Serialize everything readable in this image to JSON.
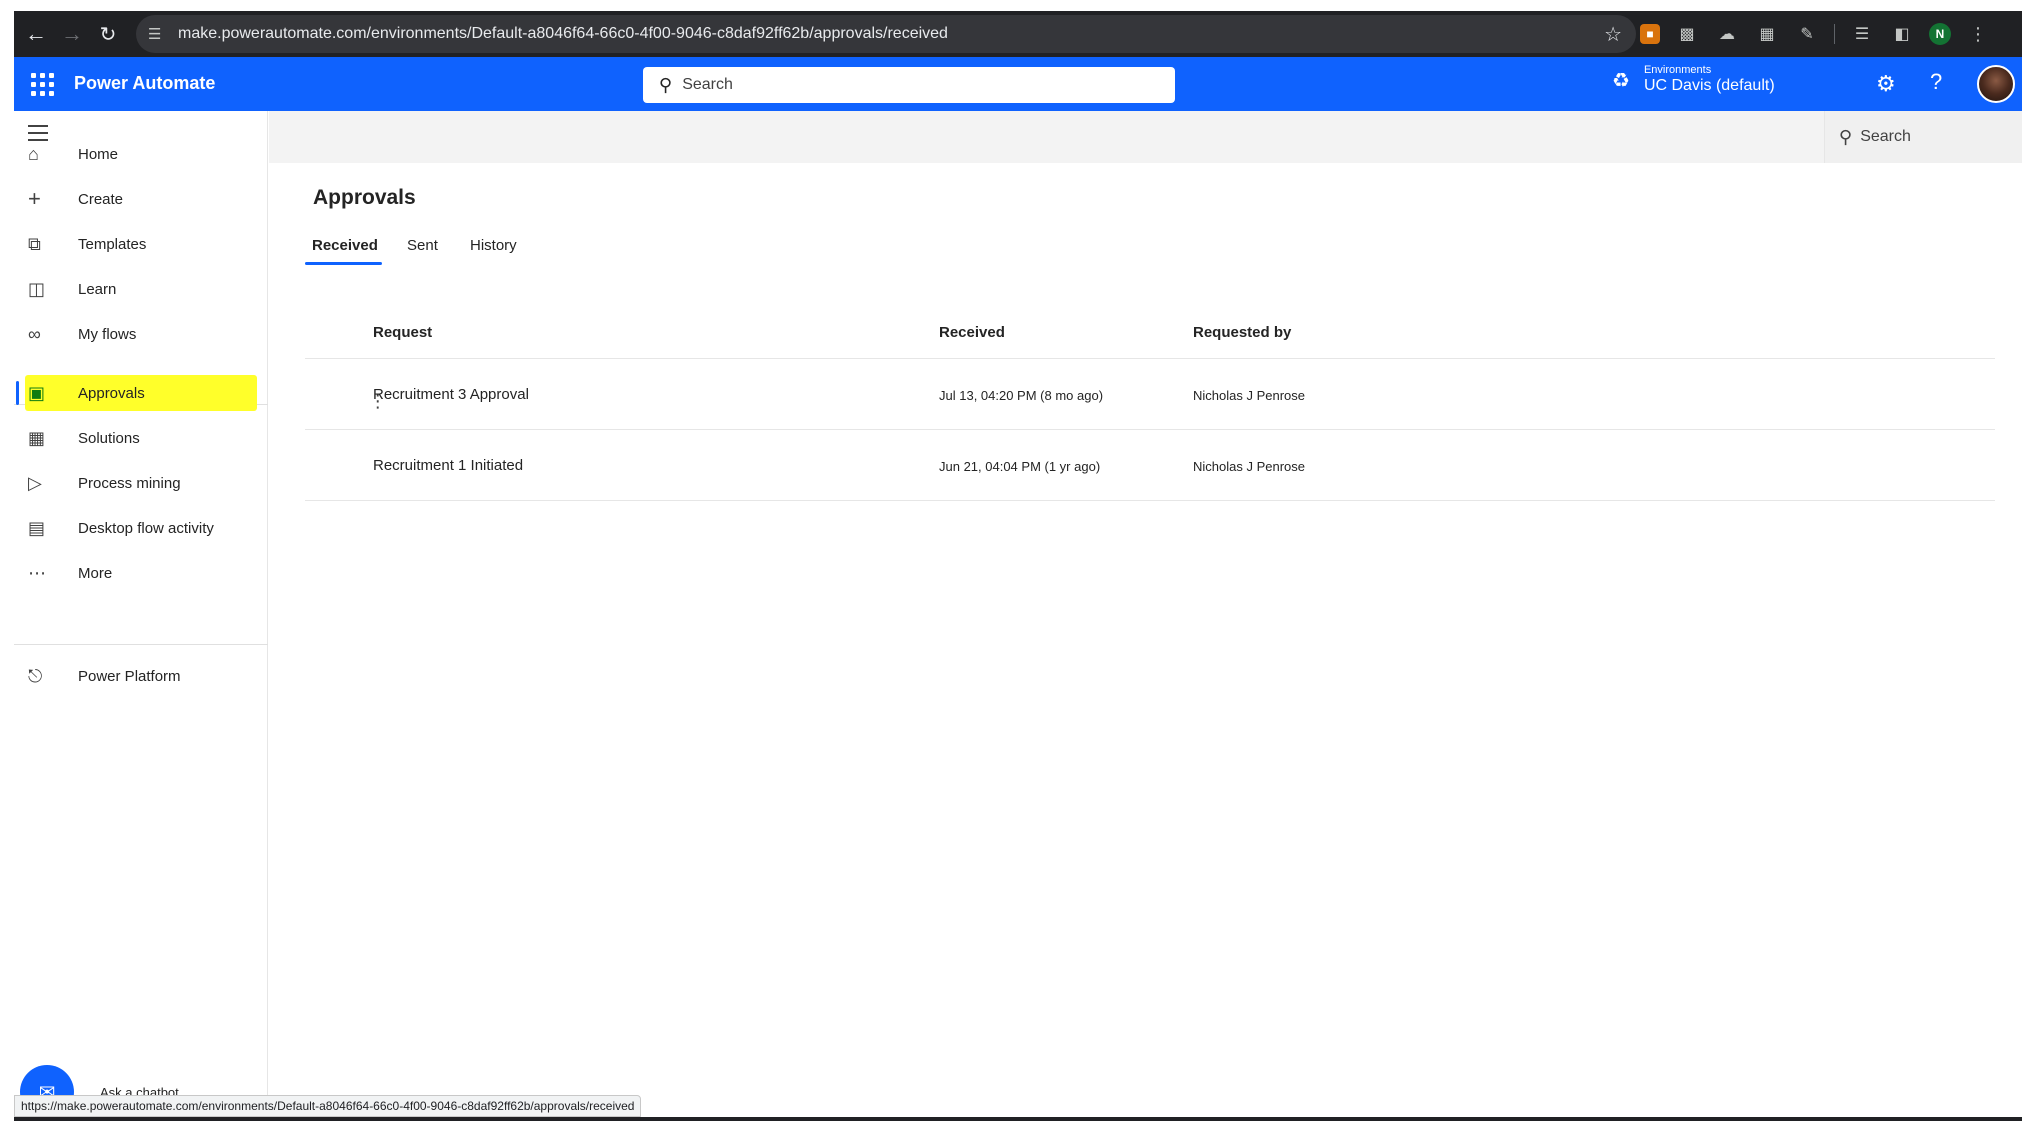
{
  "browser": {
    "url": "make.powerautomate.com/environments/Default-a8046f64-66c0-4f00-9046-c8daf92ff62b/approvals/received",
    "profile_initial": "N",
    "status_url": "https://make.powerautomate.com/environments/Default-a8046f64-66c0-4f00-9046-c8daf92ff62b/approvals/received"
  },
  "header": {
    "app_name": "Power Automate",
    "search_placeholder": "Search",
    "env_label": "Environments",
    "env_name": "UC Davis (default)",
    "accent": "#0f62fe"
  },
  "sidebar": {
    "items": [
      {
        "label": "Home",
        "icon": "home-icon"
      },
      {
        "label": "Create",
        "icon": "plus-icon"
      },
      {
        "label": "Templates",
        "icon": "templates-icon"
      },
      {
        "label": "Learn",
        "icon": "book-icon"
      },
      {
        "label": "My flows",
        "icon": "flow-icon"
      },
      {
        "label": "Approvals",
        "icon": "approvals-icon",
        "active": true
      },
      {
        "label": "Solutions",
        "icon": "solutions-icon"
      },
      {
        "label": "Process mining",
        "icon": "process-mining-icon"
      },
      {
        "label": "Desktop flow activity",
        "icon": "desktop-flow-icon"
      },
      {
        "label": "More",
        "icon": "more-icon"
      },
      {
        "label": "Power Platform",
        "icon": "power-platform-icon"
      }
    ],
    "chatbot_label": "Ask a chatbot",
    "highlight_color": "#ffff2a"
  },
  "commandbar": {
    "search_label": "Search"
  },
  "main": {
    "title": "Approvals",
    "tabs": [
      {
        "label": "Received",
        "active": true
      },
      {
        "label": "Sent"
      },
      {
        "label": "History"
      }
    ],
    "columns": [
      "Request",
      "Received",
      "Requested by"
    ],
    "rows": [
      {
        "request": "Recruitment 3 Approval",
        "received": "Jul 13, 04:20 PM (8 mo ago)",
        "requested_by": "Nicholas J Penrose"
      },
      {
        "request": "Recruitment 1 Initiated",
        "received": "Jun 21, 04:04 PM (1 yr ago)",
        "requested_by": "Nicholas J Penrose"
      }
    ]
  }
}
